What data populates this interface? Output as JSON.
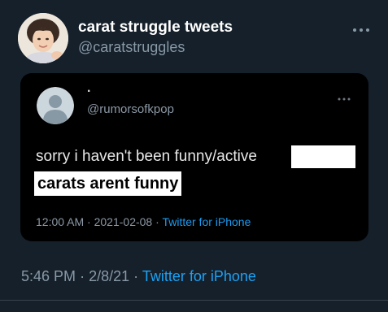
{
  "tweet": {
    "author_name": "carat struggle tweets",
    "author_handle": "@caratstruggles",
    "more_icon": "more-horizontal-icon",
    "avatar_icon": "profile-photo"
  },
  "quote": {
    "author_name": ".",
    "author_handle": "@rumorsofkpop",
    "avatar_icon": "default-avatar-icon",
    "more_icon": "more-horizontal-icon",
    "text_line1": "sorry i haven't been funny/active",
    "text_line2_highlight": "carats arent funny",
    "time": "12:00 AM",
    "date": "2021-02-08",
    "source": "Twitter for iPhone",
    "separator": "·"
  },
  "footer": {
    "time": "5:46 PM",
    "date": "2/8/21",
    "source": "Twitter for iPhone",
    "separator": "·"
  },
  "colors": {
    "background": "#15202b",
    "card_background": "#000000",
    "link": "#1da1f2",
    "secondary_text": "#8899a6",
    "primary_text": "#ffffff"
  }
}
